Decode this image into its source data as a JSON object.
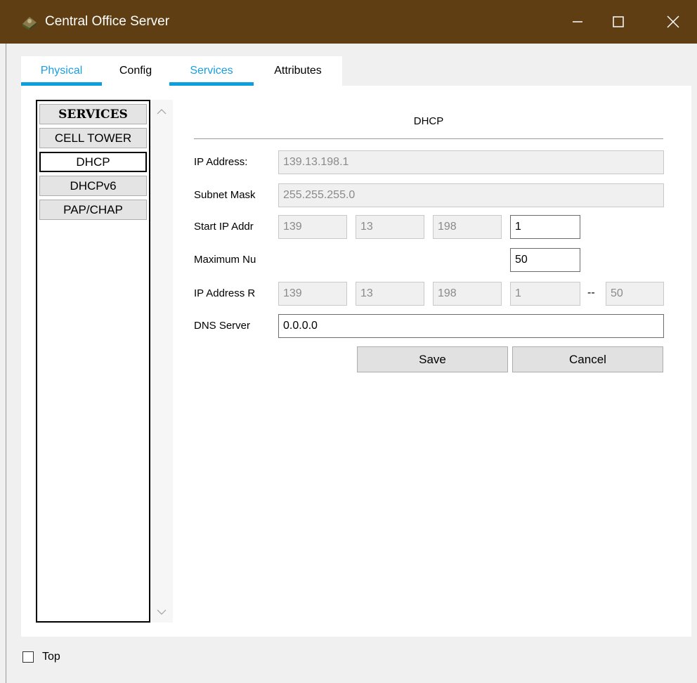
{
  "window": {
    "title": "Central Office Server",
    "icon": "cisco-device-icon",
    "controls": [
      "minimize-icon",
      "maximize-icon",
      "close-icon"
    ],
    "title_bar_color": "#5f3e13"
  },
  "tabs": [
    {
      "label": "Physical",
      "color": "#1a9fdf"
    },
    {
      "label": "Config",
      "color": "#000000"
    },
    {
      "label": "Services",
      "color": "#1a9fdf",
      "selected": true
    },
    {
      "label": "Attributes",
      "color": "#000000"
    }
  ],
  "services": {
    "header": "SERVICES",
    "items": [
      "CELL TOWER",
      "DHCP",
      "DHCPv6",
      "PAP/CHAP"
    ],
    "selected": "DHCP"
  },
  "dhcp": {
    "heading": "DHCP",
    "ip_address_label": "IP Address:",
    "ip_address": "139.13.198.1",
    "subnet_mask_label": "Subnet Mask",
    "subnet_mask": "255.255.255.0",
    "start_ip_label": "Start IP Addr",
    "start_ip": [
      "139",
      "13",
      "198",
      "1"
    ],
    "max_users_label": "Maximum Nu",
    "max_users": "50",
    "ip_range_label": "IP Address R",
    "ip_range": [
      "139",
      "13",
      "198",
      "1"
    ],
    "range_separator": "--",
    "range_end": "50",
    "dns_label": "DNS Server",
    "dns_server": "0.0.0.0",
    "save_label": "Save",
    "cancel_label": "Cancel"
  },
  "footer": {
    "top_label": "Top",
    "top_checked": false
  }
}
